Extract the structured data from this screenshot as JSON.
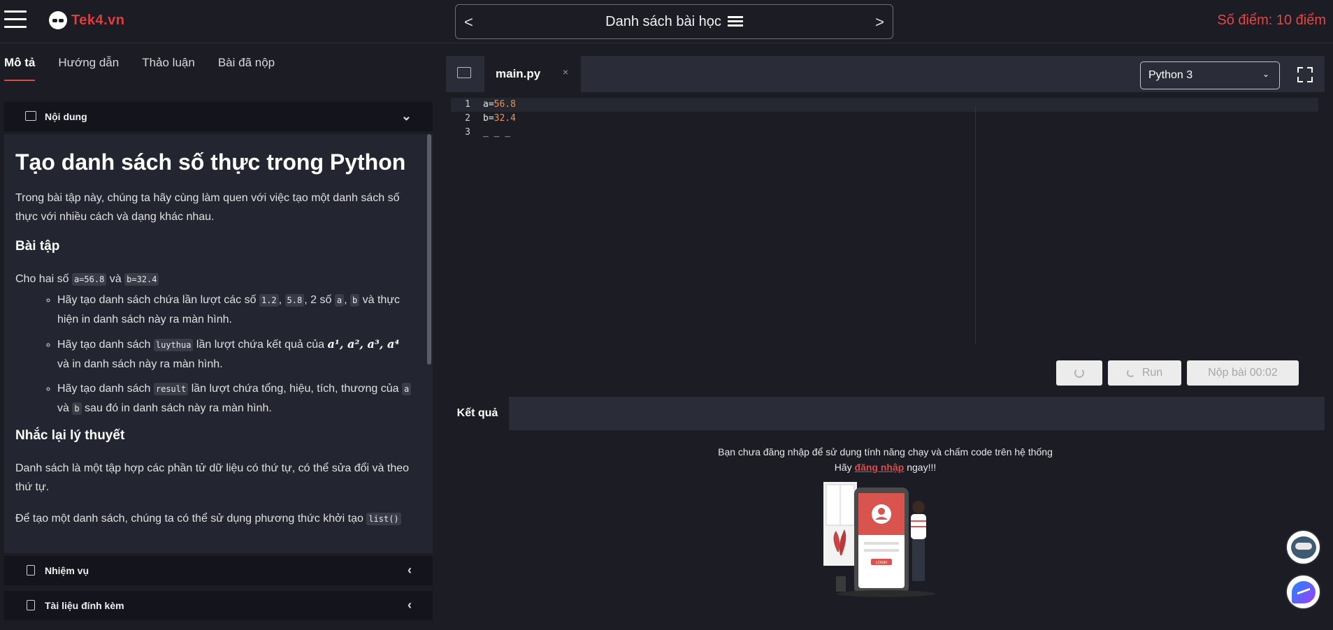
{
  "header": {
    "logo_text": "Tek4.vn",
    "lesson_nav_title": "Danh sách bài học",
    "prev_arrow": "<",
    "next_arrow": ">",
    "score_text": "Số điểm: 10 điểm"
  },
  "left_tabs": [
    "Mô tả",
    "Hướng dẫn",
    "Thảo luận",
    "Bài đã nộp"
  ],
  "sections": {
    "content_label": "Nội dung",
    "tasks_label": "Nhiệm vụ",
    "attachments_label": "Tài liệu đính kèm"
  },
  "article": {
    "title": "Tạo danh sách số thực trong Python",
    "intro": "Trong bài tập này, chúng ta hãy cùng làm quen với việc tạo một danh sách số thực với nhiều cách và dạng khác nhau.",
    "exercise_heading": "Bài tập",
    "given_prefix": "Cho hai số",
    "given_a": "a=56.8",
    "given_and": "và",
    "given_b": "b=32.4",
    "task1_a": "Hãy tạo danh sách chứa lần lượt các số",
    "task1_c1": "1.2",
    "task1_c2": "5.8",
    "task1_b": ", 2 số",
    "task1_c3": "a",
    "task1_c4": "b",
    "task1_c": "và thực hiện in danh sách này ra màn hình.",
    "task2_a": "Hãy tạo danh sách",
    "task2_code": "luythua",
    "task2_b": "lần lượt chứa kết quả của",
    "task2_math": "a¹, a², a³, a⁴",
    "task2_c": "và in danh sách này ra màn hình.",
    "task3_a": "Hãy tạo danh sách",
    "task3_code": "result",
    "task3_b": "lần lượt chứa tổng, hiệu, tích, thương của",
    "task3_c1": "a",
    "task3_and": "và",
    "task3_c2": "b",
    "task3_c": "sau đó in danh sách này ra màn hình.",
    "theory_heading": "Nhắc lại lý thuyết",
    "theory_p1": "Danh sách là một tập hợp các phần tử dữ liệu có thứ tự, có thể sửa đổi và theo thứ tự.",
    "theory_p2": "Để tạo một danh sách, chúng ta có thể sử dụng phương thức khởi tạo",
    "theory_p2_code": "list()"
  },
  "editor": {
    "file_name": "main.py",
    "close_glyph": "×",
    "language": "Python 3",
    "lines": [
      {
        "num": "1",
        "var": "a=",
        "val": "56.8"
      },
      {
        "num": "2",
        "var": "b=",
        "val": "32.4"
      },
      {
        "num": "3",
        "var": "_ _ _",
        "val": ""
      }
    ],
    "run_label": "Run",
    "submit_label": "Nộp bài 00:02"
  },
  "result": {
    "tab_label": "Kết quả",
    "msg_line1": "Bạn chưa đăng nhập để sử dụng tính năng chạy và chấm code trên hệ thống",
    "msg_prefix": "Hãy",
    "login_link": "đăng nhập",
    "msg_suffix": "ngay!!!",
    "illus_login_label": "LOGIN"
  },
  "colors": {
    "accent": "#e04848",
    "background": "#1b1c24",
    "panel": "#232530"
  },
  "icons": [
    "hamburger-icon",
    "list-icon",
    "book-icon",
    "chevron-down-icon",
    "clipboard-icon",
    "file-icon",
    "chevron-left-icon",
    "folder-icon",
    "close-icon",
    "fullscreen-icon",
    "reset-icon",
    "spinner-icon",
    "chatbot-icon",
    "messenger-icon"
  ]
}
